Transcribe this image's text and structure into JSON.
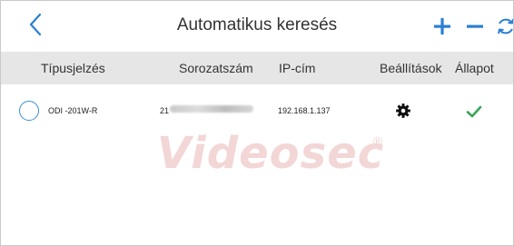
{
  "window": {
    "title": "Automatikus keresés"
  },
  "toolbar": {
    "back_icon": "chevron-left-icon",
    "add_icon": "plus-icon",
    "remove_icon": "minus-icon",
    "refresh_icon": "refresh-icon",
    "accent": "#2a7fd4"
  },
  "table": {
    "columns": [
      "Típusjelzés",
      "Sorozatszám",
      "IP-cím",
      "Beállítások",
      "Állapot"
    ],
    "rows": [
      {
        "model": "ODI -201W-R",
        "serial_visible": "21",
        "ip": "192.168.1.137",
        "settings_icon": "gear-icon",
        "status_icon": "check-icon",
        "status_color": "#3aa55a"
      }
    ]
  },
  "watermark": {
    "text": "Videosec",
    "mark": "®"
  }
}
